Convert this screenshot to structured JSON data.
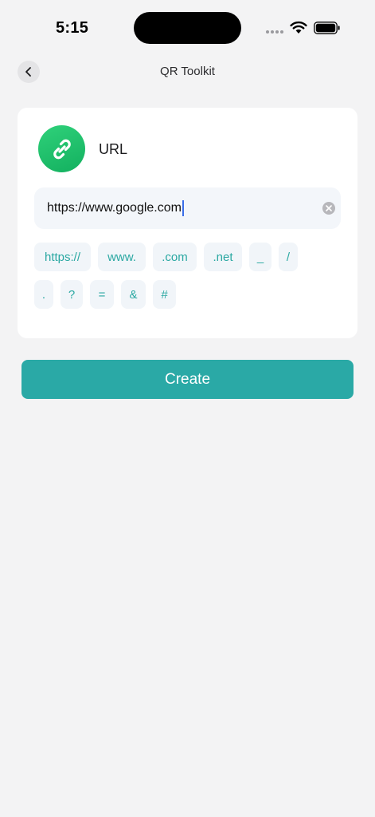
{
  "status_bar": {
    "time": "5:15"
  },
  "nav": {
    "title": "QR Toolkit"
  },
  "card": {
    "type_label": "URL",
    "url_value": "https://www.google.com",
    "chips_row1": [
      "https://",
      "www.",
      ".com",
      ".net",
      "_",
      "/"
    ],
    "chips_row2": [
      ".",
      "?",
      "=",
      "&",
      "#"
    ]
  },
  "actions": {
    "create_label": "Create"
  },
  "colors": {
    "accent": "#2aa9a6",
    "chip_text": "#2aa8a2",
    "icon_green": "#1fbe6b",
    "background": "#f3f3f4"
  },
  "icons": {
    "back": "chevron-left-icon",
    "type": "link-icon",
    "clear": "clear-circle-icon"
  }
}
